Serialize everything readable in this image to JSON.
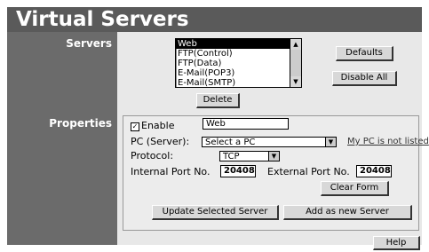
{
  "title": "Virtual Servers",
  "sidebar": {
    "servers_label": "Servers",
    "properties_label": "Properties"
  },
  "servers": {
    "items": [
      "Web",
      "FTP(Control)",
      "FTP(Data)",
      "E-Mail(POP3)",
      "E-Mail(SMTP)"
    ],
    "selected": "Web",
    "defaults_label": "Defaults",
    "disable_all_label": "Disable All",
    "delete_label": "Delete"
  },
  "properties": {
    "enable_label": "Enable",
    "enable_checked": true,
    "name_value": "Web",
    "pc_label": "PC (Server):",
    "pc_selected": "Select a PC",
    "pc_not_listed_link": "My PC is not listed",
    "protocol_label": "Protocol:",
    "protocol_selected": "TCP",
    "internal_port_label": "Internal Port No.",
    "internal_port_value": "20408",
    "external_port_label": "External Port No.",
    "external_port_value": "20408",
    "clear_form_label": "Clear Form"
  },
  "actions": {
    "update_label": "Update Selected Server",
    "add_label": "Add as new Server",
    "help_label": "Help"
  }
}
